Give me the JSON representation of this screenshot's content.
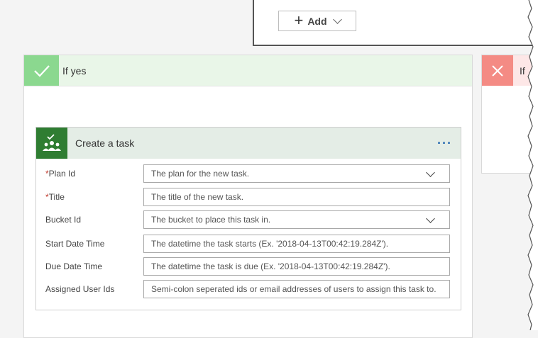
{
  "condition": {
    "add_label": "Add"
  },
  "yes_branch": {
    "title": "If yes"
  },
  "no_branch": {
    "title": "If"
  },
  "task": {
    "title": "Create a task",
    "fields": [
      {
        "label": "Plan Id",
        "required": true,
        "placeholder": "The plan for the new task.",
        "dropdown": true
      },
      {
        "label": "Title",
        "required": true,
        "placeholder": "The title of the new task.",
        "dropdown": false
      },
      {
        "label": "Bucket Id",
        "required": false,
        "placeholder": "The bucket to place this task in.",
        "dropdown": true
      },
      {
        "label": "Start Date Time",
        "required": false,
        "placeholder": "The datetime the task starts (Ex. '2018-04-13T00:42:19.284Z').",
        "dropdown": false
      },
      {
        "label": "Due Date Time",
        "required": false,
        "placeholder": "The datetime the task is due (Ex. '2018-04-13T00:42:19.284Z').",
        "dropdown": false
      },
      {
        "label": "Assigned User Ids",
        "required": false,
        "placeholder": "Semi-colon seperated ids or email addresses of users to assign this task to.",
        "dropdown": false
      }
    ]
  },
  "colors": {
    "yes_accent": "#8bd88f",
    "no_accent": "#f48b84",
    "planner_green": "#2f7d32",
    "menu_blue": "#2f6fb3"
  }
}
